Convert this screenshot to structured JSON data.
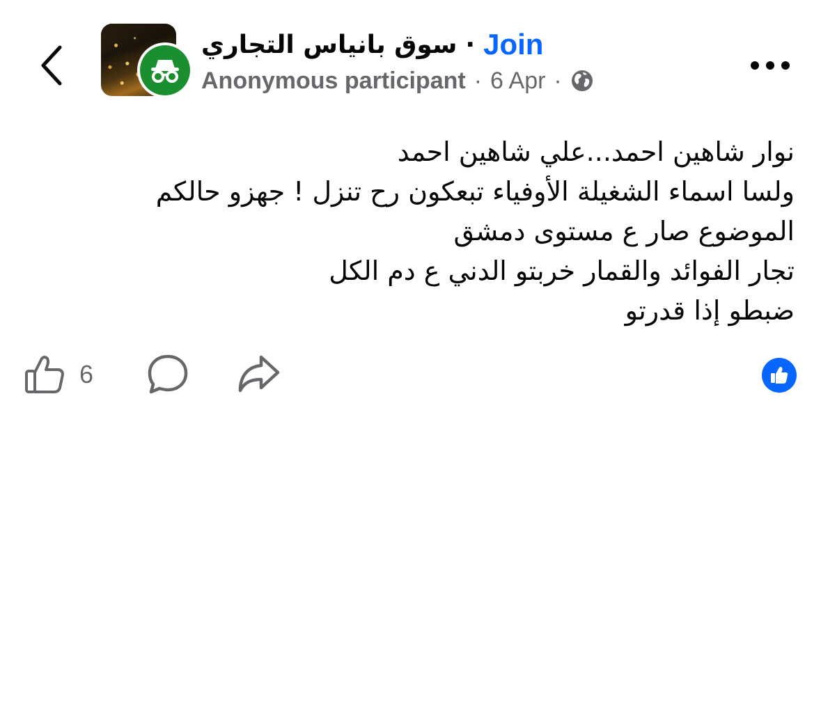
{
  "header": {
    "back_icon": "chevron-left-icon",
    "group_name": "سوق بانياس التجاري",
    "separator": "·",
    "join_label": "Join",
    "author": "Anonymous participant",
    "date": "6 Apr",
    "privacy_icon": "globe-icon",
    "more_icon": "more-horizontal-icon",
    "badge_icon": "anonymous-incognito-icon",
    "badge_color": "#1b8f2f"
  },
  "post": {
    "lines": [
      "نوار شاهين احمد...علي شاهين احمد",
      "ولسا اسماء الشغيلة الأوفياء تبعكون رح تنزل ! جهزو حالكم",
      "الموضوع صار ع مستوى دمشق",
      "تجار الفوائد والقمار خربتو الدني ع دم الكل",
      "ضبطو إذا قدرتو"
    ]
  },
  "actions": {
    "like_icon": "thumbs-up-outline-icon",
    "like_count": "6",
    "comment_icon": "comment-bubble-icon",
    "share_icon": "share-arrow-icon",
    "reaction_icon": "like-reaction-icon",
    "accent_color": "#0866ff"
  }
}
